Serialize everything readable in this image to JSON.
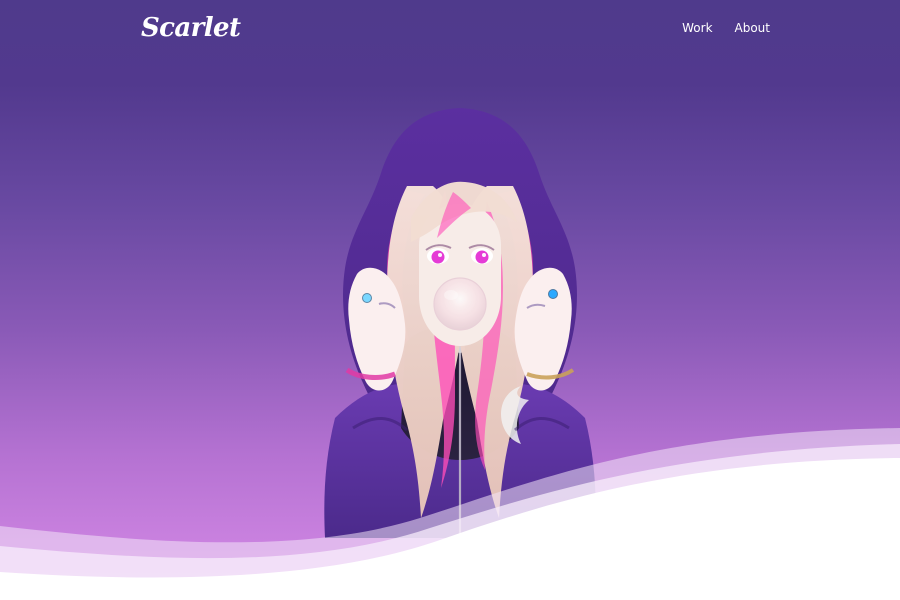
{
  "header": {
    "brand": "Scarlet",
    "nav": [
      {
        "label": "Work"
      },
      {
        "label": "About"
      }
    ]
  },
  "hero": {
    "illustration_subject": "anime girl in purple hoodie blowing bubble gum"
  },
  "colors": {
    "gradient_top": "#4f3a8c",
    "gradient_bottom": "#d78be8",
    "hoodie": "#5a2f9a",
    "hair": "#f1ddd3",
    "accent_pink": "#e33aa8",
    "wave": "#ffffff"
  }
}
